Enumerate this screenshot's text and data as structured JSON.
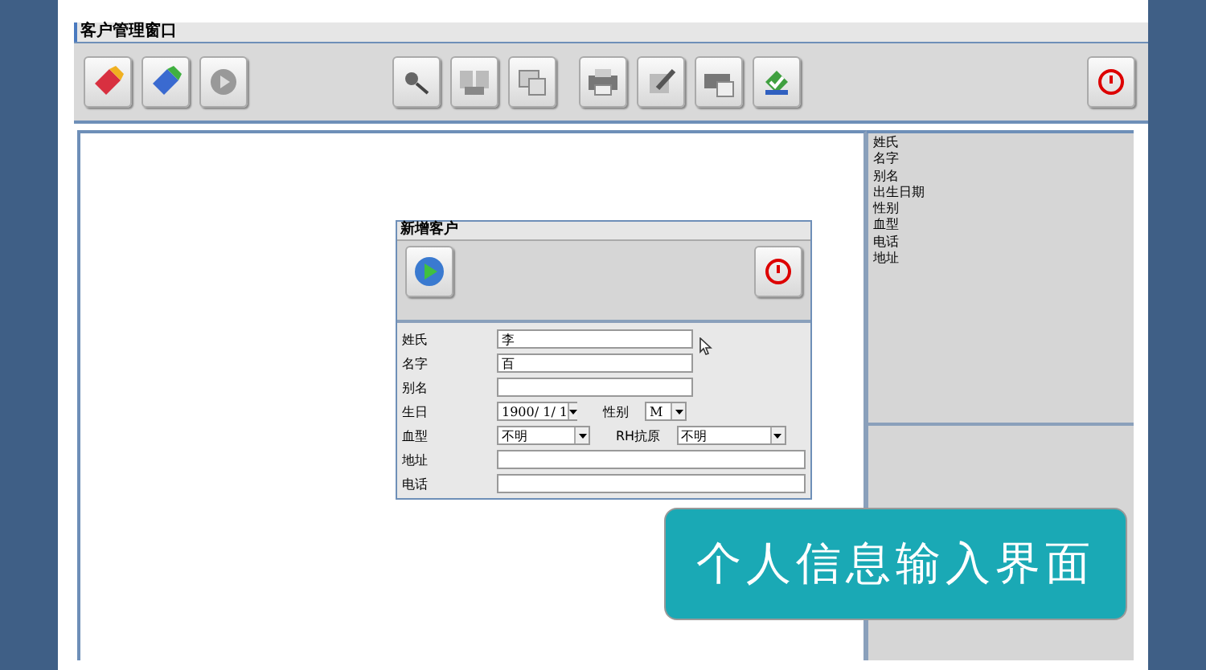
{
  "window": {
    "title": "客户管理窗口"
  },
  "dialog": {
    "title": "新增客户",
    "rows": [
      {
        "items": [
          {
            "label": "姓氏",
            "kind": "text",
            "value": "李"
          }
        ]
      },
      {
        "items": [
          {
            "label": "名字",
            "kind": "text",
            "value": "百"
          }
        ]
      },
      {
        "items": [
          {
            "label": "别名",
            "kind": "text"
          }
        ]
      },
      {
        "items": [
          {
            "label": "生日",
            "kind": "combo",
            "value": "1900/ 1/ 1"
          },
          {
            "label": "性别",
            "kind": "combo",
            "value": "M"
          }
        ]
      },
      {
        "items": [
          {
            "label": "血型",
            "kind": "combo",
            "value": "不明"
          },
          {
            "label": "RH抗原",
            "kind": "combo",
            "value": "不明"
          }
        ]
      },
      {
        "items": [
          {
            "label": "地址",
            "kind": "wide"
          }
        ]
      },
      {
        "items": [
          {
            "label": "电话",
            "kind": "wide"
          }
        ]
      }
    ]
  },
  "side_fields": [
    "姓氏",
    "名字",
    "别名",
    "出生日期",
    "性别",
    "血型",
    "电话",
    "地址"
  ],
  "caption": "个人信息输入界面"
}
